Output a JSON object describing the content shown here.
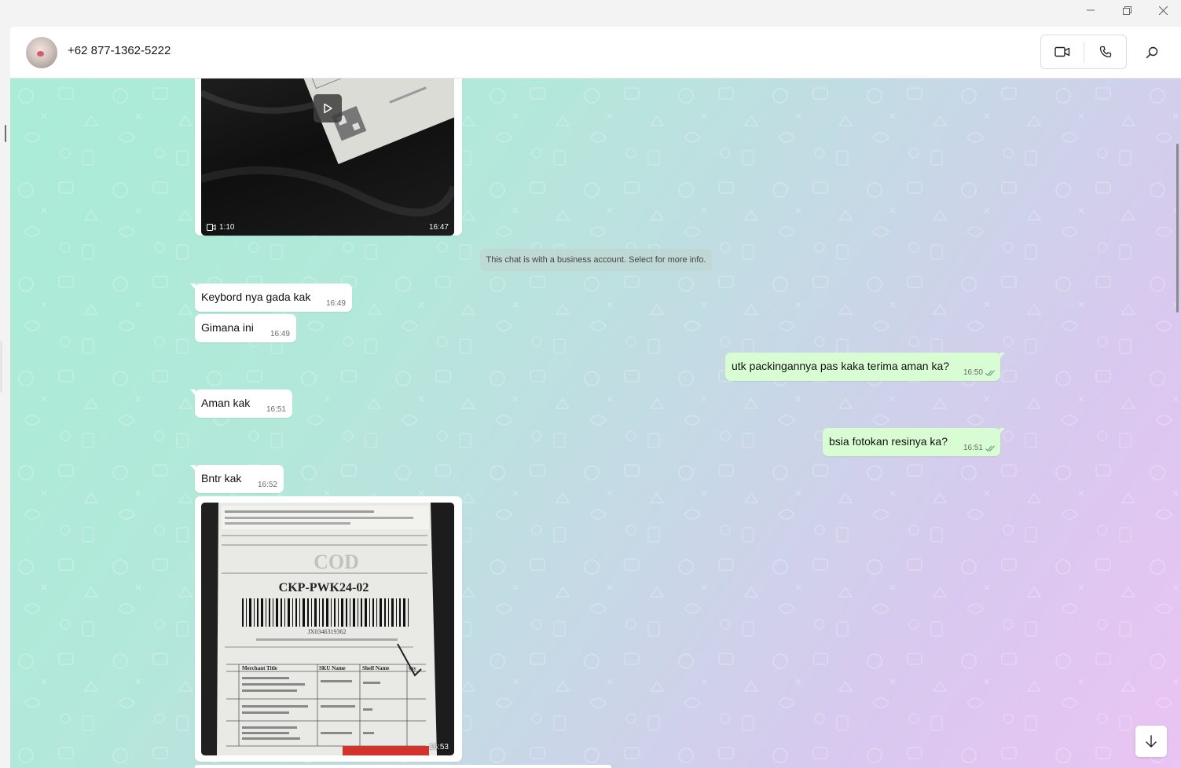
{
  "window": {
    "controls": [
      "minimize-icon",
      "maximize-icon",
      "close-icon"
    ]
  },
  "header": {
    "contact_name": "+62 877-1362-5222",
    "icons": [
      "video-call-icon",
      "voice-call-icon",
      "search-icon"
    ]
  },
  "messages": [
    {
      "type": "video",
      "direction": "in",
      "duration": "1:10",
      "time": "16:47"
    },
    {
      "type": "system",
      "text": "This chat is with a business account. Select for more info."
    },
    {
      "type": "text",
      "direction": "in",
      "text": "Keybord nya gada kak",
      "time": "16:49"
    },
    {
      "type": "text",
      "direction": "in",
      "text": "Gimana ini",
      "time": "16:49"
    },
    {
      "type": "text",
      "direction": "out",
      "text": "utk packingannya pas kaka terima aman ka?",
      "time": "16:50",
      "status": "read"
    },
    {
      "type": "text",
      "direction": "in",
      "text": "Aman kak",
      "time": "16:51"
    },
    {
      "type": "text",
      "direction": "out",
      "text": "bsia fotokan resinya ka?",
      "time": "16:51",
      "status": "read"
    },
    {
      "type": "text",
      "direction": "in",
      "text": "Bntr kak",
      "time": "16:52"
    },
    {
      "type": "image",
      "direction": "in",
      "time": "16:53"
    }
  ],
  "receipt": {
    "label_cod": "COD",
    "code": "CKP-PWK24-02",
    "barcode_number": "JX0346319362",
    "columns": [
      "Merchant Title",
      "SKU Name",
      "Shelf Name",
      "Qty"
    ],
    "rows": [
      [
        "Tempered Glass 11\" Samsung S7 S8 S9 A9+ 11\" / Redmi Pad SE 11\"",
        "F83-SM-RM-11",
        "15A-B",
        "1"
      ],
      [
        "Case Only-Case Redmi SE Macaron",
        "F87-REDMI-SE11-BLACK",
        "4E",
        "1"
      ],
      [
        "Wireless Bluetooth Keyboard 10inch Macaron Colourful / Touch Keyboard",
        "Q96-BLACK",
        "17B",
        "1"
      ]
    ]
  },
  "colors": {
    "incoming_bubble": "#ffffff",
    "outgoing_bubble": "#d9fdd3",
    "read_ticks": "#53bdeb",
    "background_start": "#a9ecd7",
    "background_end": "#eac4f3"
  }
}
